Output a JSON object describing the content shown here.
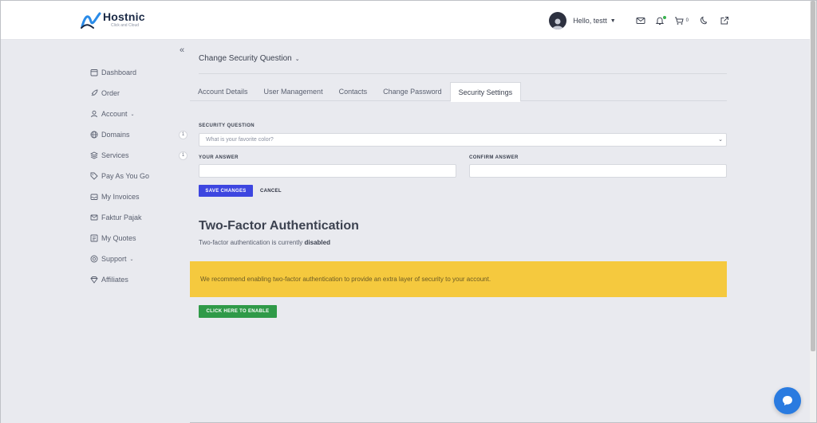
{
  "brand": {
    "name": "Hostnic",
    "tagline": "Click and Cloud"
  },
  "header": {
    "greeting": "Hello, testt",
    "cart_count": "0",
    "accent": "#3d46e0"
  },
  "sidebar": {
    "items": [
      {
        "label": "Dashboard",
        "icon": "calendar-icon"
      },
      {
        "label": "Order",
        "icon": "rocket-icon"
      },
      {
        "label": "Account",
        "icon": "user-icon",
        "has_submenu": true
      },
      {
        "label": "Domains",
        "icon": "globe-icon",
        "badge": "1"
      },
      {
        "label": "Services",
        "icon": "layers-icon",
        "badge": "1"
      },
      {
        "label": "Pay As You Go",
        "icon": "tag-icon"
      },
      {
        "label": "My Invoices",
        "icon": "inbox-icon"
      },
      {
        "label": "Faktur Pajak",
        "icon": "mail-icon"
      },
      {
        "label": "My Quotes",
        "icon": "list-icon"
      },
      {
        "label": "Support",
        "icon": "lifebuoy-icon",
        "has_submenu": true
      },
      {
        "label": "Affiliates",
        "icon": "diamond-icon"
      }
    ]
  },
  "main": {
    "title": "Change Security Question",
    "tabs": [
      {
        "label": "Account Details",
        "active": false
      },
      {
        "label": "User Management",
        "active": false
      },
      {
        "label": "Contacts",
        "active": false
      },
      {
        "label": "Change Password",
        "active": false
      },
      {
        "label": "Security Settings",
        "active": true
      }
    ],
    "form": {
      "question_label": "SECURITY QUESTION",
      "question_value": "What is your favorite color?",
      "answer_label": "YOUR ANSWER",
      "answer_value": "",
      "confirm_label": "CONFIRM ANSWER",
      "confirm_value": "",
      "save_label": "SAVE CHANGES",
      "cancel_label": "CANCEL"
    },
    "tfa": {
      "title": "Two-Factor Authentication",
      "status_prefix": "Two-factor authentication is currently",
      "status_value": "disabled",
      "alert_text": "We recommend enabling two-factor authentication to provide an extra layer of security to your account.",
      "enable_label": "CLICK HERE TO ENABLE",
      "alert_color": "#f5c93e",
      "enable_color": "#2f9a48"
    }
  }
}
